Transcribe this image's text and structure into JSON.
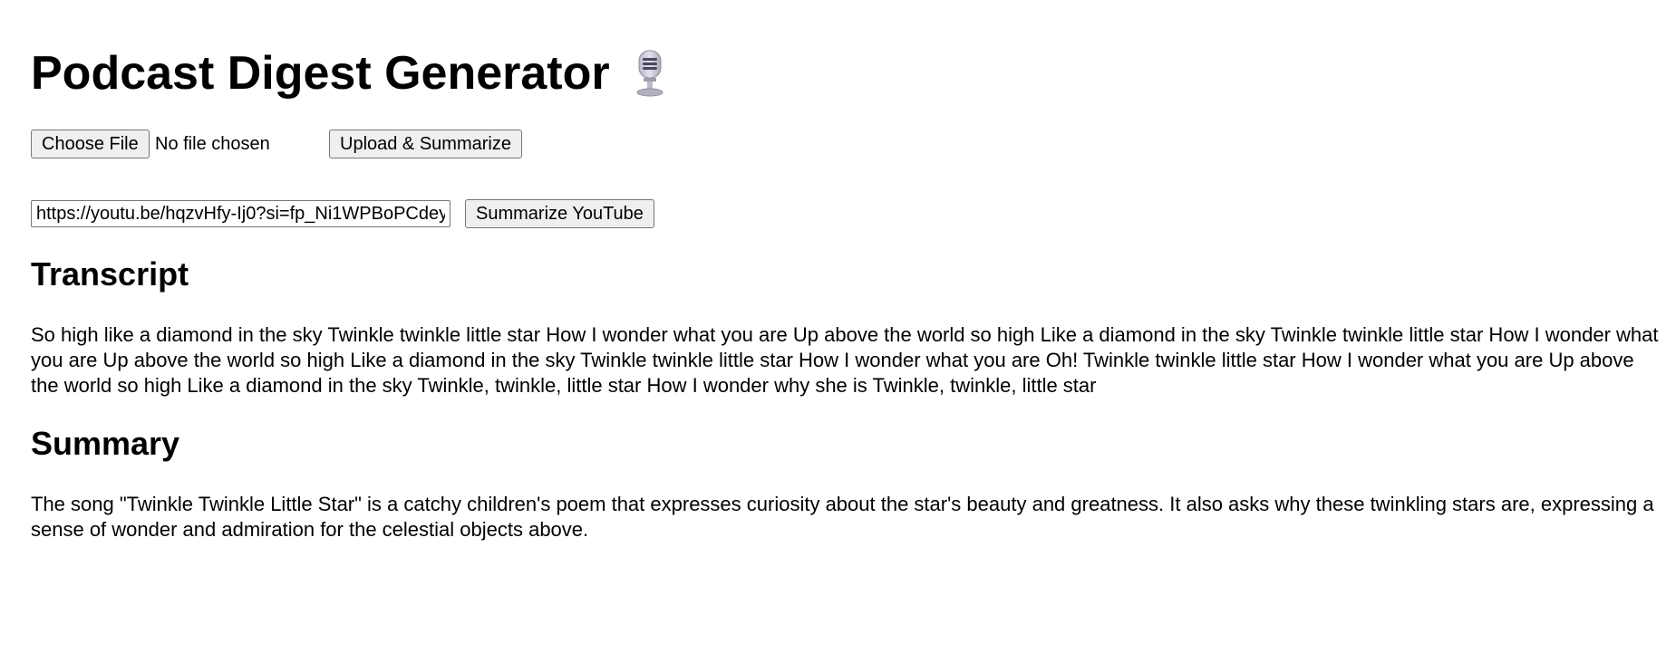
{
  "header": {
    "title": "Podcast Digest Generator",
    "icon": "microphone-icon"
  },
  "upload": {
    "choose_file_label": "Choose File",
    "file_status": "No file chosen",
    "submit_label": "Upload & Summarize"
  },
  "youtube": {
    "url_value": "https://youtu.be/hqzvHfy-Ij0?si=fp_Ni1WPBoPCdey",
    "submit_label": "Summarize YouTube"
  },
  "transcript": {
    "heading": "Transcript",
    "text": "So high like a diamond in the sky Twinkle twinkle little star How I wonder what you are Up above the world so high Like a diamond in the sky Twinkle twinkle little star How I wonder what you are Up above the world so high Like a diamond in the sky Twinkle twinkle little star How I wonder what you are Oh! Twinkle twinkle little star How I wonder what you are Up above the world so high Like a diamond in the sky Twinkle, twinkle, little star How I wonder why she is Twinkle, twinkle, little star"
  },
  "summary": {
    "heading": "Summary",
    "text": "The song \"Twinkle Twinkle Little Star\" is a catchy children's poem that expresses curiosity about the star's beauty and greatness. It also asks why these twinkling stars are, expressing a sense of wonder and admiration for the celestial objects above."
  }
}
